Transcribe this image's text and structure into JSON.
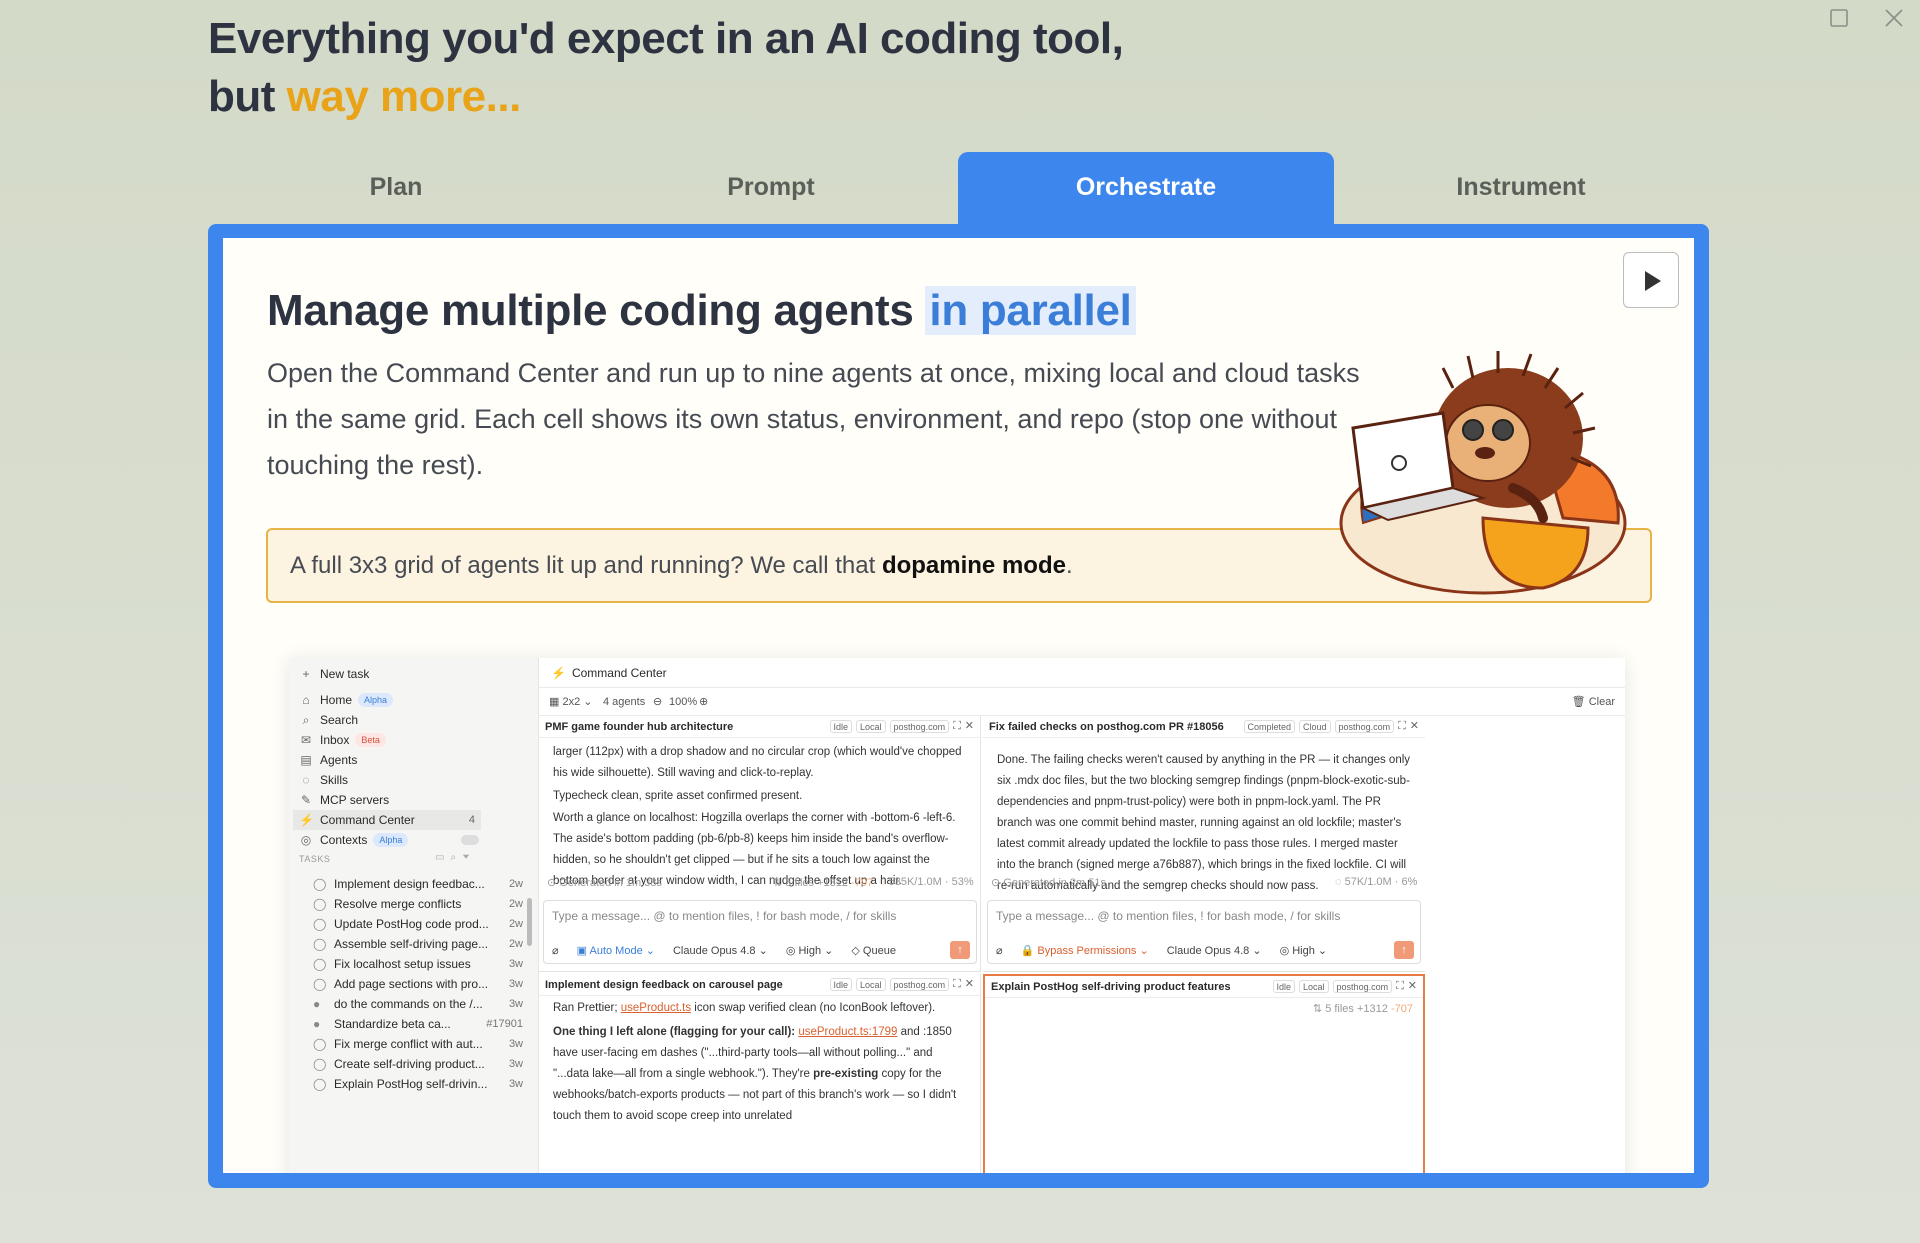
{
  "window": {
    "maximize_icon": "square-icon",
    "close_icon": "close-icon"
  },
  "hero": {
    "line1": "Everything you'd expect in an AI coding tool,",
    "line2_prefix": "but ",
    "line2_accent": "way more...",
    "accent_color": "#e8a319"
  },
  "tabs": [
    {
      "label": "Plan",
      "active": false
    },
    {
      "label": "Prompt",
      "active": false
    },
    {
      "label": "Orchestrate",
      "active": true
    },
    {
      "label": "Instrument",
      "active": false
    }
  ],
  "panel": {
    "accent_color": "#3d86ee",
    "play_icon": "play-icon",
    "title_prefix": "Manage multiple coding agents ",
    "title_highlight": "in parallel",
    "description": "Open the Command Center and run up to nine agents at once, mixing local and cloud tasks in the same grid. Each cell shows its own status, environment, and repo (stop one without touching the rest).",
    "callout_prefix": "A full 3x3 grid of agents lit up and running? We call that ",
    "callout_bold": "dopamine mode",
    "callout_suffix": "."
  },
  "app": {
    "sidebar": {
      "new_task": "New task",
      "nav": [
        {
          "icon": "home-icon",
          "glyph": "⌂",
          "label": "Home",
          "badge": "Alpha",
          "badge_style": "blue"
        },
        {
          "icon": "search-icon",
          "glyph": "⌕",
          "label": "Search"
        },
        {
          "icon": "inbox-icon",
          "glyph": "✉",
          "label": "Inbox",
          "badge": "Beta",
          "badge_style": "red"
        },
        {
          "icon": "agents-icon",
          "glyph": "▤",
          "label": "Agents"
        },
        {
          "icon": "skills-icon",
          "glyph": "◌",
          "label": "Skills"
        },
        {
          "icon": "mcp-icon",
          "glyph": "✎",
          "label": "MCP servers"
        },
        {
          "icon": "lightning-icon",
          "glyph": "⚡",
          "label": "Command Center",
          "count": "4",
          "active": true
        },
        {
          "icon": "contexts-icon",
          "glyph": "◎",
          "label": "Contexts",
          "badge": "Alpha",
          "badge_style": "blue"
        }
      ],
      "tasks_label": "TASKS",
      "tasks": [
        {
          "title": "Implement design feedbac...",
          "age": "2w"
        },
        {
          "title": "Resolve merge conflicts",
          "age": "2w"
        },
        {
          "title": "Update PostHog code prod...",
          "age": "2w"
        },
        {
          "title": "Assemble self-driving page...",
          "age": "2w"
        },
        {
          "title": "Fix localhost setup issues",
          "age": "3w"
        },
        {
          "title": "Add page sections with pro...",
          "age": "3w"
        },
        {
          "title": "do the commands on the /...",
          "age": "3w"
        },
        {
          "title": "Standardize beta ca...",
          "age": "#17901"
        },
        {
          "title": "Fix merge conflict with aut...",
          "age": "3w"
        },
        {
          "title": "Create self-driving product...",
          "age": "3w"
        },
        {
          "title": "Explain PostHog self-drivin...",
          "age": "3w"
        }
      ]
    },
    "header": {
      "title": "Command Center",
      "layout": "2x2",
      "agents": "4 agents",
      "zoom": "100%",
      "clear": "Clear"
    },
    "cells": [
      {
        "title": "PMF game founder hub architecture",
        "tags": [
          "Idle",
          "Local",
          "posthog.com"
        ],
        "lines": [
          "larger (112px) with a drop shadow and no circular crop (which would've chopped his wide silhouette). Still waving and click-to-replay.",
          "Typecheck clean, sprite asset confirmed present.",
          "Worth a glance on localhost: Hogzilla overlaps the corner with -bottom-6 -left-6. The aside's bottom padding (pb-6/pb-8) keeps him inside the band's overflow-hidden, so he shouldn't get clipped — but if he sits a touch low against the bottom border at your window width, I can nudge the offset up a hair."
        ],
        "generated": "Generated in 1m 38s",
        "files": "5 files",
        "added": "+1312",
        "removed": "-707",
        "tokens": "535K/1.0M · 53%",
        "placeholder": "Type a message... @ to mention files, ! for bash mode, / for skills",
        "mode": "Auto Mode",
        "model": "Claude Opus 4.8",
        "effort": "High",
        "queue": "Queue"
      },
      {
        "title": "Fix failed checks on posthog.com PR #18056",
        "tags": [
          "Completed",
          "Cloud",
          "posthog.com"
        ],
        "lines": [
          "Done. The failing checks weren't caused by anything in the PR — it changes only six .mdx doc files, but the two blocking semgrep findings (pnpm-block-exotic-sub-dependencies and pnpm-trust-policy) were both in pnpm-lock.yaml. The PR branch was one commit behind master, running against an old lockfile; master's latest commit already updated the lockfile to pass those rules. I merged master into the branch (signed merge a76b887), which brings in the fixed lockfile. CI will re-run automatically and the semgrep checks should now pass."
        ],
        "generated": "Generated in 2m 51s",
        "tokens": "57K/1.0M · 6%",
        "placeholder": "Type a message... @ to mention files, ! for bash mode, / for skills",
        "mode": "Bypass Permissions",
        "model": "Claude Opus 4.8",
        "effort": "High"
      },
      {
        "title": "Implement design feedback on carousel page",
        "tags": [
          "Idle",
          "Local",
          "posthog.com"
        ],
        "line1_prefix": "Ran Prettier; ",
        "line1_link": "useProduct.ts",
        "line1_suffix": " icon swap verified clean (no IconBook leftover).",
        "line2_bold": "One thing I left alone (flagging for your call):",
        "line2_link": "useProduct.ts:1799",
        "line2_rest": " and :1850 have user-facing em dashes (\"...third-party tools—all without polling...\" and \"...data lake—all from a single webhook.\"). They're ",
        "line2_bold2": "pre-existing",
        "line2_end": " copy for the webhooks/batch-exports products — not part of this branch's work — so I didn't touch them to avoid scope creep into unrelated"
      },
      {
        "title": "Explain PostHog self-driving product features",
        "tags": [
          "Idle",
          "Local",
          "posthog.com"
        ],
        "files": "5 files",
        "added": "+1312",
        "removed": "-707"
      }
    ]
  }
}
